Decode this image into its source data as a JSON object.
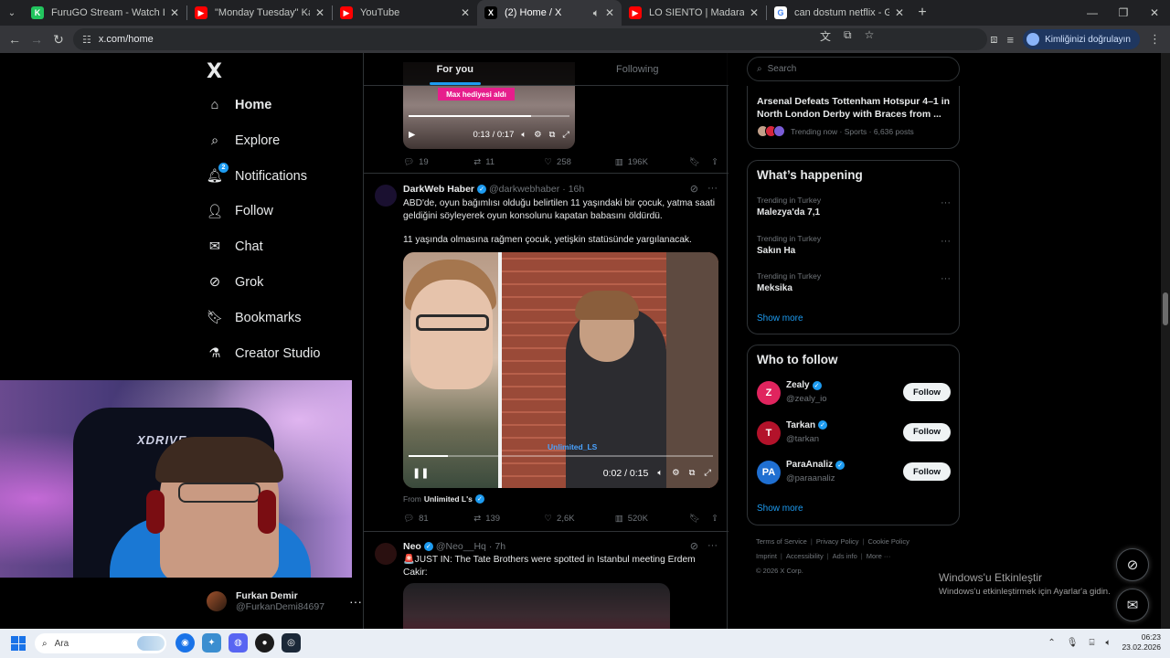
{
  "browser": {
    "tabs": [
      {
        "title": "FuruGO Stream - Watch Live on",
        "favicon_color": "#22c55e",
        "favicon_glyph": "K",
        "width": 178
      },
      {
        "title": "\"Monday Tuesday\" Karma Video",
        "favicon_color": "#ff0000",
        "favicon_glyph": "▶",
        "width": 158
      },
      {
        "title": "YouTube",
        "favicon_color": "#ff0000",
        "favicon_glyph": "▶",
        "width": 158
      },
      {
        "title": "(2) Home / X",
        "favicon_color": "#000000",
        "favicon_glyph": "X",
        "width": 158,
        "active": true,
        "muted_icon": true
      },
      {
        "title": "LO SIENTO | Madara Olduk #65",
        "favicon_color": "#ff0000",
        "favicon_glyph": "▶",
        "width": 158
      },
      {
        "title": "can dostum netflix - Google'da",
        "favicon_color": "#ffffff",
        "favicon_glyph": "G",
        "width": 158
      }
    ],
    "url": "x.com/home",
    "profile_label": "Kimliğinizi doğrulayın"
  },
  "nav": {
    "logo": "X",
    "items": [
      {
        "label": "Home",
        "icon": "home-icon",
        "active": true
      },
      {
        "label": "Explore",
        "icon": "search-icon"
      },
      {
        "label": "Notifications",
        "icon": "bell-icon",
        "badge": "2"
      },
      {
        "label": "Follow",
        "icon": "person-add-icon"
      },
      {
        "label": "Chat",
        "icon": "mail-icon"
      },
      {
        "label": "Grok",
        "icon": "grok-icon"
      },
      {
        "label": "Bookmarks",
        "icon": "bookmark-icon"
      },
      {
        "label": "Creator Studio",
        "icon": "flask-icon"
      }
    ],
    "account": {
      "name": "Furkan Demir",
      "handle": "@FurkanDemi84697",
      "more": "···"
    }
  },
  "webcam": {
    "chair_label": "XDRIVE"
  },
  "feed": {
    "tabs": [
      {
        "label": "For you",
        "active": true
      },
      {
        "label": "Following"
      }
    ],
    "first_post": {
      "overlay_text": "Max hediyesi aldı",
      "time": "0:13 / 0:17",
      "progress": 0.76,
      "stats": {
        "replies": "19",
        "reposts": "11",
        "likes": "258",
        "views": "196K"
      }
    },
    "second_post": {
      "name": "DarkWeb Haber",
      "handle": "@darkwebhaber",
      "dot": "·",
      "time": "16h",
      "text1": "ABD'de, oyun bağımlısı olduğu belirtilen 11 yaşındaki bir çocuk, yatma saati geldiğini söyleyerek oyun konsolunu kapatan babasını öldürdü.",
      "text2": "11 yaşında olmasına rağmen çocuk, yetişkin statüsünde yargılanacak.",
      "video_watermark": "Unlimited_LS",
      "video_time": "0:02 / 0:15",
      "progress": 0.13,
      "from_prefix": "From",
      "from_name": "Unlimited L's",
      "stats": {
        "replies": "81",
        "reposts": "139",
        "likes": "2,6K",
        "views": "520K"
      }
    },
    "third_post": {
      "name": "Neo",
      "handle": "@Neo__Hq",
      "dot": "·",
      "time": "7h",
      "text": "🚨JUST IN: The Tate Brothers were spotted in Istanbul meeting Erdem Cakir:"
    }
  },
  "sidebar": {
    "search_placeholder": "Search",
    "news": {
      "title": "Arsenal Defeats Tottenham Hotspur 4–1 in North London Derby with Braces from ...",
      "meta": "Trending now · Sports · 6,636 posts"
    },
    "whats_happening": {
      "title": "What’s happening",
      "trends": [
        {
          "context": "Trending in Turkey",
          "name": "Malezya'da 7,1"
        },
        {
          "context": "Trending in Turkey",
          "name": "Sakın Ha"
        },
        {
          "context": "Trending in Turkey",
          "name": "Meksika"
        }
      ],
      "show_more": "Show more"
    },
    "who_to_follow": {
      "title": "Who to follow",
      "users": [
        {
          "name": "Zealy",
          "handle": "@zealy_io",
          "button": "Follow",
          "avatar_color": "#e0245e",
          "glyph": "Z"
        },
        {
          "name": "Tarkan",
          "handle": "@tarkan",
          "button": "Follow",
          "avatar_color": "#b3122a",
          "glyph": "T"
        },
        {
          "name": "ParaAnaliz",
          "handle": "@paraanaliz",
          "button": "Follow",
          "avatar_color": "#1f6fd1",
          "glyph": "PA"
        }
      ],
      "show_more": "Show more"
    },
    "footer": {
      "links1": [
        "Terms of Service",
        "Privacy Policy",
        "Cookie Policy"
      ],
      "links2": [
        "Imprint",
        "Accessibility",
        "Ads info",
        "More ···"
      ],
      "copyright": "© 2026 X Corp."
    }
  },
  "windows": {
    "activate_title": "Windows'u Etkinleştir",
    "activate_sub": "Windows'u etkinleştirmek için Ayarlar'a gidin.",
    "search_placeholder": "Ara",
    "time": "06:23",
    "date": "23.02.2026"
  }
}
